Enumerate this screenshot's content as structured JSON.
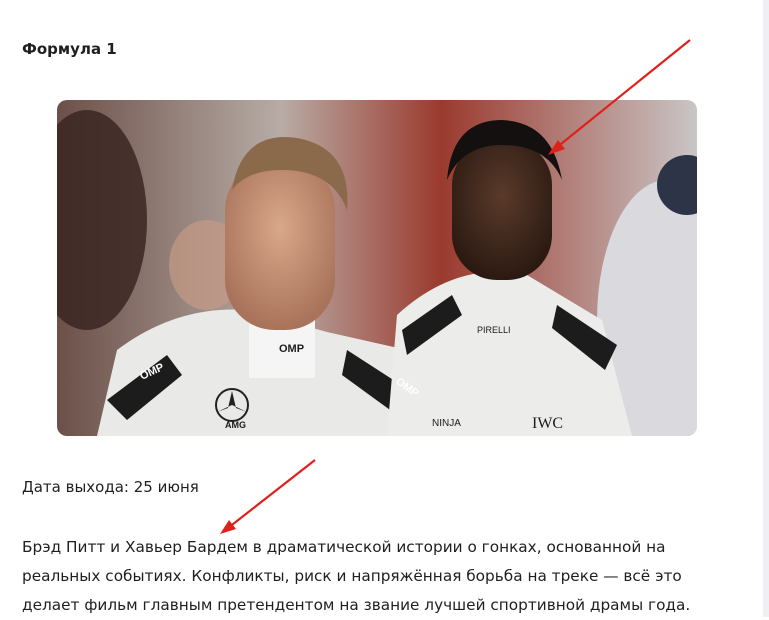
{
  "article": {
    "heading": "Формула 1",
    "release_date": "Дата выхода: 25 июня",
    "description_lines": [
      "Брэд Питт и Хавьер Бардем в драматической истории о гонках, основанной на",
      "реальных событиях. Конфликты, риск и напряжённая борьба на треке — всё это",
      "делает фильм главным претендентом на звание лучшей спортивной драмы года."
    ]
  },
  "photo": {
    "suit_logos": [
      "OMP",
      "OMP",
      "OMP",
      "AMG",
      "NINJA",
      "IWC",
      "PIRELLI"
    ]
  },
  "colors": {
    "annotation_arrow": "#e0201b",
    "text": "#1f1f1f"
  }
}
